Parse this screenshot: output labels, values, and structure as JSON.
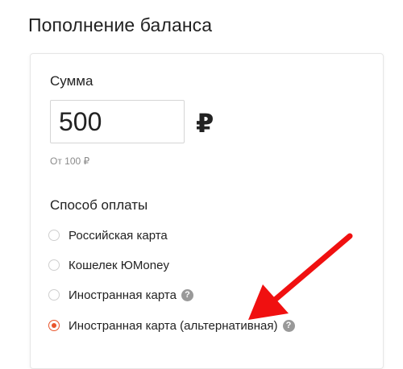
{
  "header": {
    "title": "Пополнение баланса"
  },
  "amount": {
    "label": "Сумма",
    "value": "500",
    "currency": "₽",
    "hint": "От 100 ₽"
  },
  "payment": {
    "label": "Способ оплаты",
    "options": [
      {
        "label": "Российская карта",
        "selected": false,
        "help": false
      },
      {
        "label": "Кошелек ЮMoney",
        "selected": false,
        "help": false
      },
      {
        "label": "Иностранная карта",
        "selected": false,
        "help": true
      },
      {
        "label": "Иностранная карта (альтернативная)",
        "selected": true,
        "help": true
      }
    ],
    "help_glyph": "?"
  },
  "colors": {
    "accent": "#e9552c",
    "annotation_arrow": "#f01010"
  }
}
